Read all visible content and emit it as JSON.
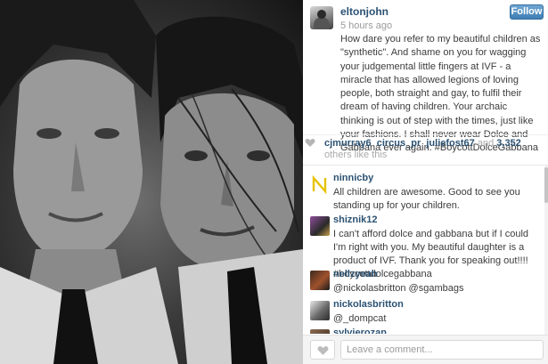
{
  "post": {
    "username": "eltonjohn",
    "timestamp": "5 hours ago",
    "follow_label": "Follow",
    "caption": "How dare you refer to my beautiful children as \"synthetic\". And shame on you for wagging your judgemental little fingers at IVF - a miracle that has allowed legions of loving people, both straight and gay, to fulfil their dream of having children. Your archaic thinking is out of step with the times, just like your fashions. I shall never wear Dolce and Gabbana ever again. #BoycottDolceGabbana"
  },
  "likes": {
    "likers": [
      "cjmurray6",
      "circus_pr",
      "juliefost67"
    ],
    "separator": ",",
    "and_text": "and",
    "count": "3,352",
    "others_text": "others like this"
  },
  "comments": [
    {
      "user": "ninnicby",
      "text": "All children are awesome. Good to see you standing up for your children.",
      "avatar": "letter-n"
    },
    {
      "user": "shiznik12",
      "text": "I can't afford dolce and gabbana but if I could I'm right with you. My beautiful daughter is a product of IVF. Thank you for speaking out!!!! #boycottdolcegabbana",
      "avatar": "photo"
    },
    {
      "user": "nellzyeah",
      "text": "@nickolasbritton @sgambags",
      "avatar": "photo"
    },
    {
      "user": "nickolasbritton",
      "text": "@_dompcat",
      "avatar": "photo"
    },
    {
      "user": "sylvierozan",
      "text": "",
      "avatar": "photo"
    }
  ],
  "footer": {
    "comment_placeholder": "Leave a comment..."
  },
  "colors": {
    "username_blue": "#2b5273",
    "follow_button": "#3f7fb5",
    "muted_text": "#9a9a9a"
  },
  "icons": {
    "like_heart": "heart-icon",
    "ninnicby_avatar": "letter-n"
  }
}
